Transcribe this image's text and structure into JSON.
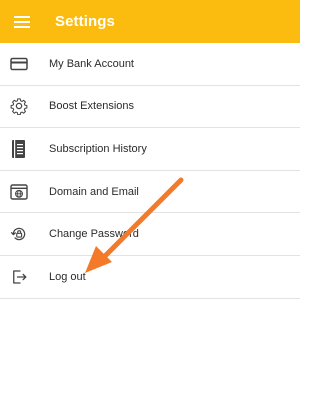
{
  "appbar": {
    "title": "Settings",
    "menu_icon": "hamburger-menu-icon",
    "background": "#fbbc0f"
  },
  "settings": {
    "items": [
      {
        "label": "My Bank Account",
        "icon": "credit-card-icon"
      },
      {
        "label": "Boost Extensions",
        "icon": "gear-icon"
      },
      {
        "label": "Subscription History",
        "icon": "ledger-book-icon"
      },
      {
        "label": "Domain and Email",
        "icon": "browser-globe-icon"
      },
      {
        "label": "Change Password",
        "icon": "lock-reset-icon"
      },
      {
        "label": "Log out",
        "icon": "logout-icon"
      }
    ]
  },
  "annotation": {
    "color": "#f47a2a",
    "points_to": "Log out"
  }
}
